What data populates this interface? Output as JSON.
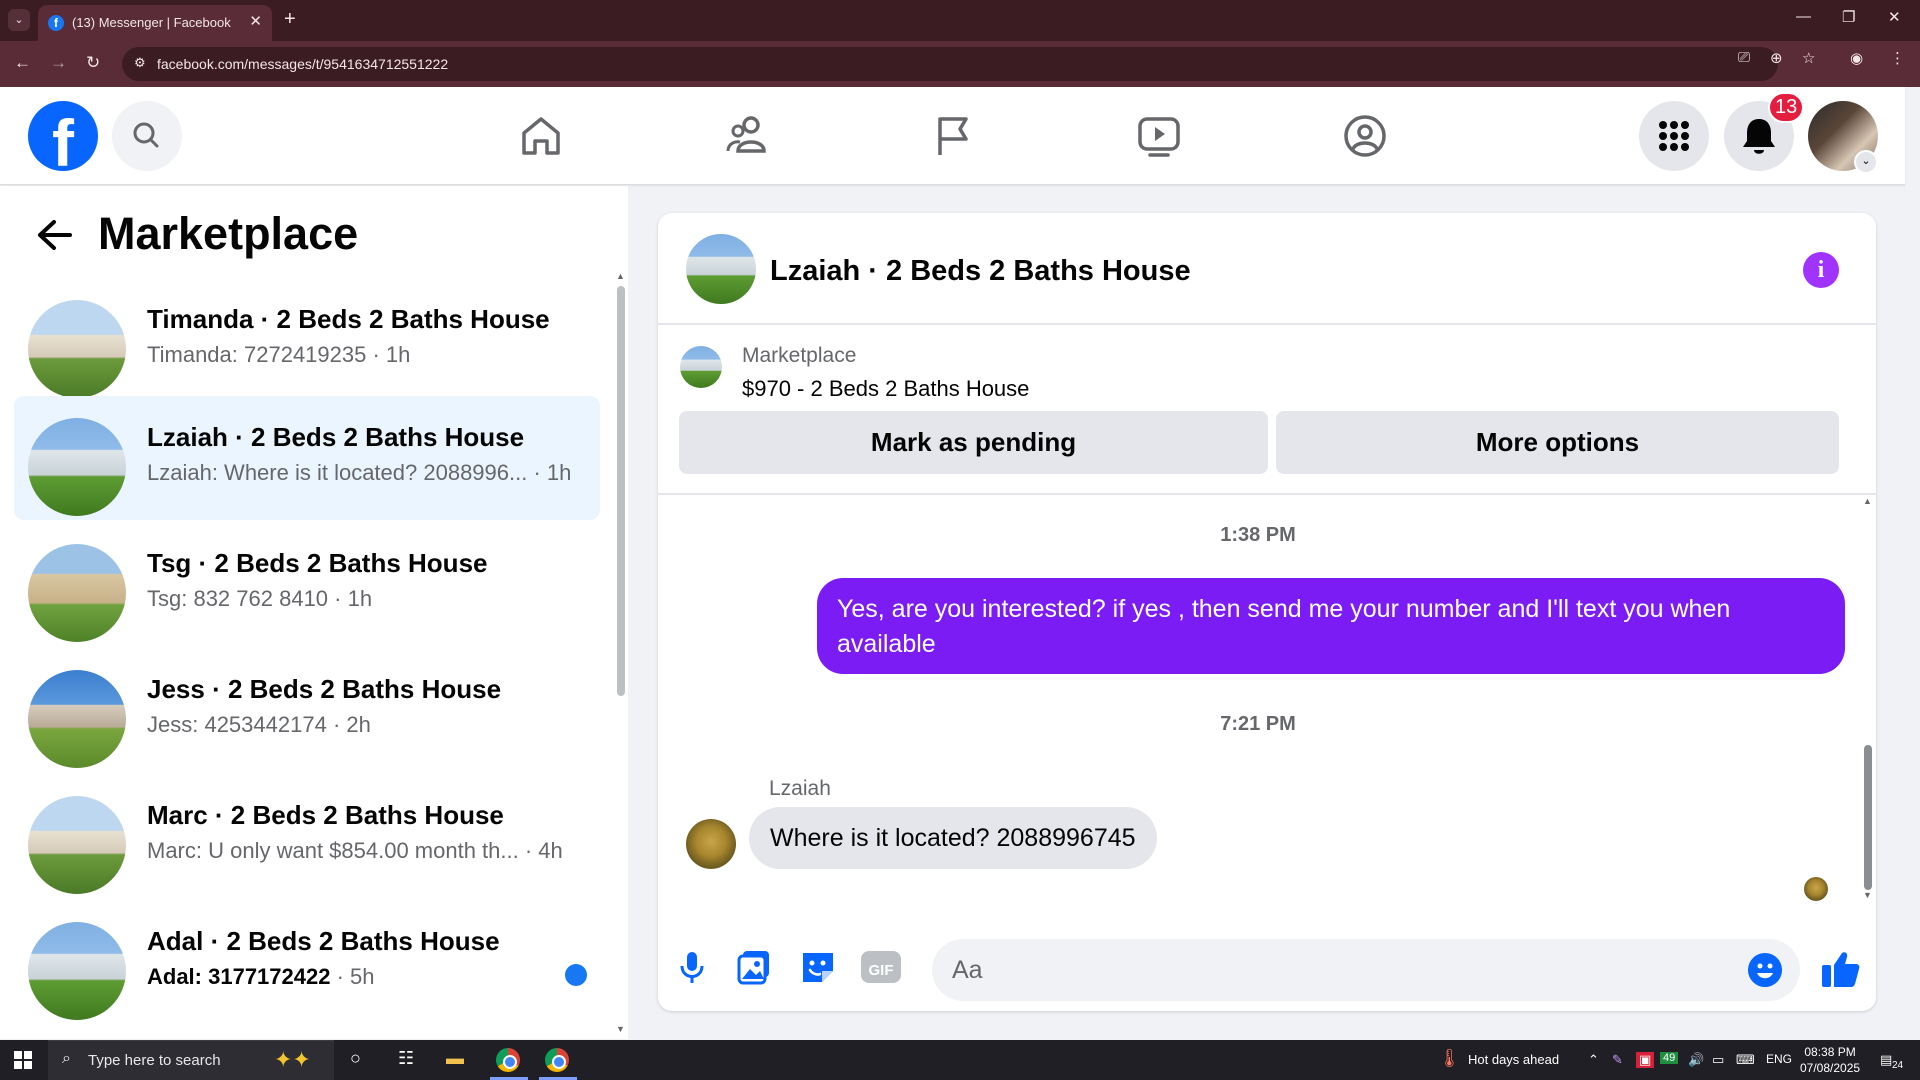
{
  "browser": {
    "tab_title": "(13) Messenger | Facebook",
    "url": "facebook.com/messages/t/9541634712551222"
  },
  "header": {
    "notification_count": "13",
    "logo_letter": "f"
  },
  "sidebar": {
    "title": "Marketplace",
    "conversations": [
      {
        "name": "Timanda · 2 Beds 2 Baths House",
        "preview": "Timanda: 7272419235",
        "time": " · 1h",
        "unread": false,
        "active": false
      },
      {
        "name": "Lzaiah · 2 Beds 2 Baths House",
        "preview": "Lzaiah: Where is it located? 2088996...",
        "time": " · 1h",
        "unread": false,
        "active": true
      },
      {
        "name": "Tsg · 2 Beds 2 Baths House",
        "preview": "Tsg: 832 762 8410",
        "time": " · 1h",
        "unread": false,
        "active": false
      },
      {
        "name": "Jess · 2 Beds 2 Baths House",
        "preview": "Jess: 4253442174",
        "time": " · 2h",
        "unread": false,
        "active": false
      },
      {
        "name": "Marc · 2 Beds 2 Baths House",
        "preview": "Marc: U only want $854.00 month th...",
        "time": " · 4h",
        "unread": false,
        "active": false
      },
      {
        "name": "Adal · 2 Beds 2 Baths House",
        "preview": "Adal: 3177172422",
        "time": " · 5h",
        "unread": true,
        "active": false
      }
    ]
  },
  "chat": {
    "title": "Lzaiah · 2 Beds 2 Baths House",
    "listing_label": "Marketplace",
    "listing_title": "$970 - 2 Beds 2 Baths House",
    "mark_pending_label": "Mark as pending",
    "more_options_label": "More options",
    "timestamp1": "1:38 PM",
    "outgoing_message": "Yes, are you interested? if yes , then send me your number and I'll text you when available",
    "timestamp2": "7:21 PM",
    "incoming_sender": "Lzaiah",
    "incoming_message": "Where is it located? 2088996745",
    "input_placeholder": "Aa"
  },
  "taskbar": {
    "search_placeholder": "Type here to search",
    "weather": "Hot days ahead",
    "language": "ENG",
    "time": "08:38 PM",
    "date": "07/08/2025",
    "notif_count": "24",
    "tray_badge": "49"
  },
  "colors": {
    "fb_blue": "#0866ff",
    "messenger_purple": "#7c1cf4",
    "active_conv": "#ebf5ff",
    "badge_red": "#e41e3f",
    "browser_frame": "#3b1c22"
  },
  "icons": [
    "facebook-logo",
    "search-icon",
    "home-icon",
    "friends-icon",
    "flag-icon",
    "video-icon",
    "gaming-icon",
    "menu-grid-icon",
    "bell-icon",
    "back-arrow-icon",
    "info-icon",
    "mic-icon",
    "image-icon",
    "sticker-icon",
    "gif-icon",
    "emoji-icon",
    "like-icon"
  ]
}
